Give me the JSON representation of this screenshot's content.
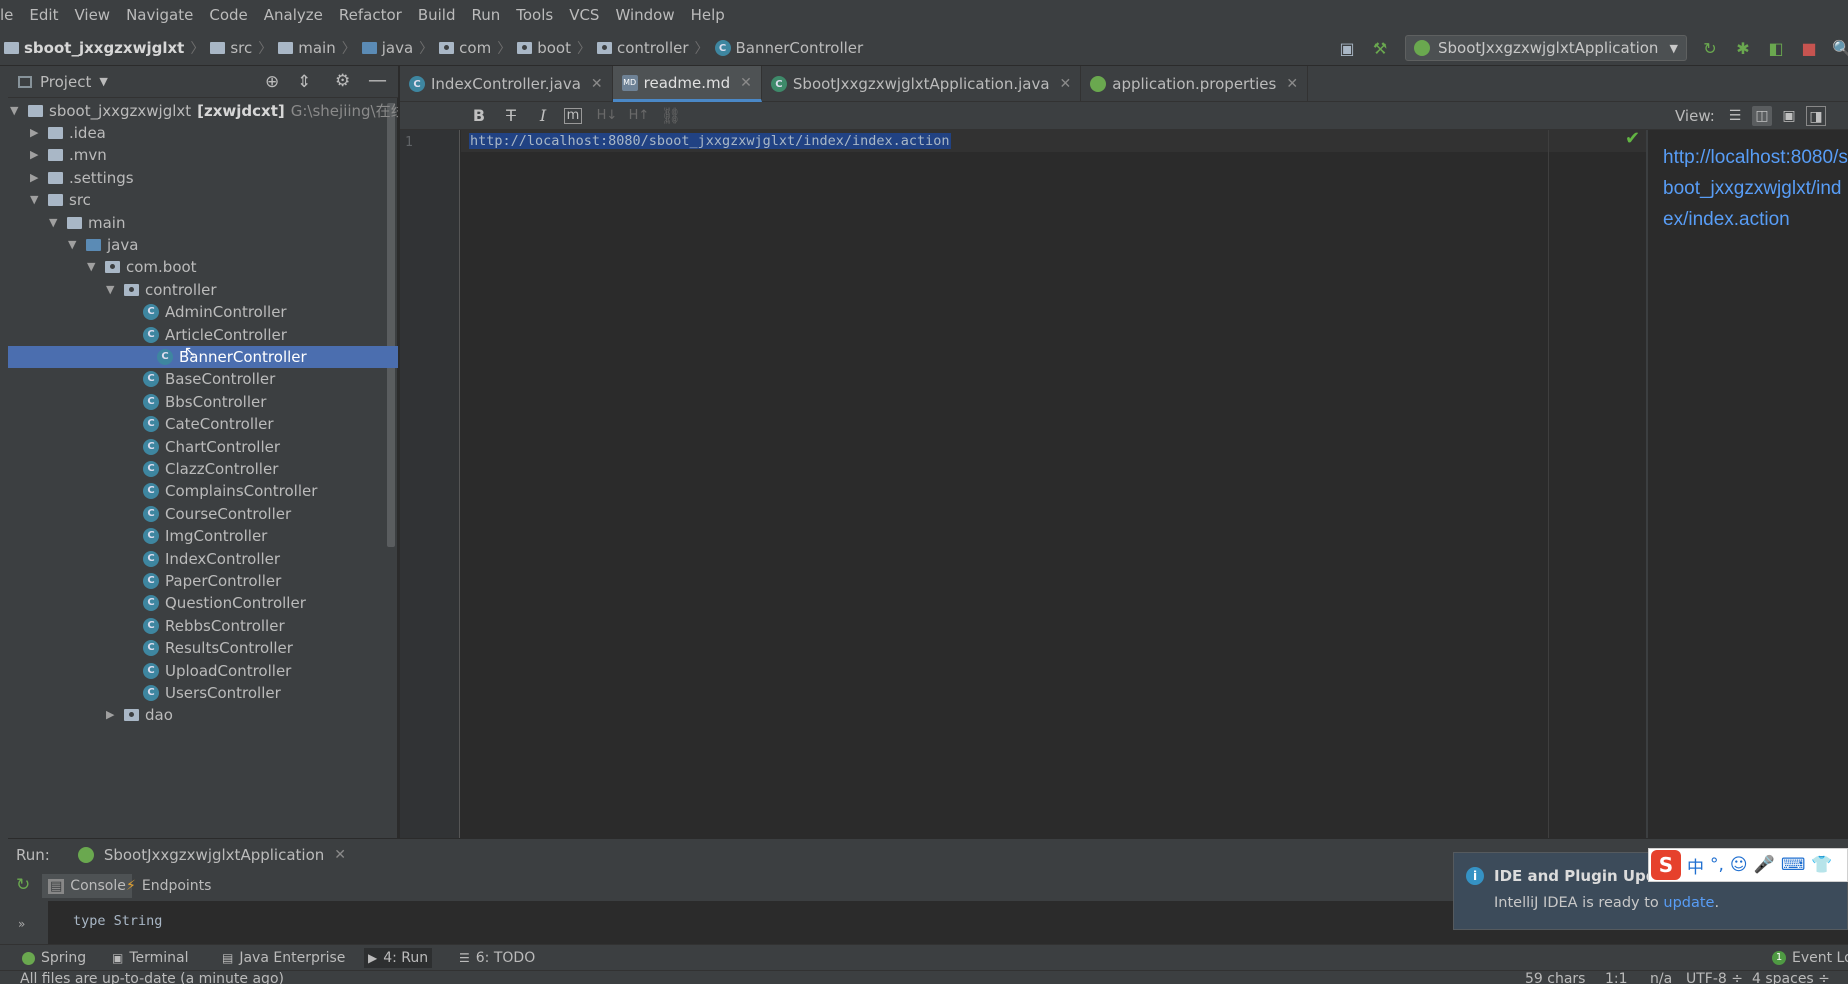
{
  "menu": [
    "le",
    "Edit",
    "View",
    "Navigate",
    "Code",
    "Analyze",
    "Refactor",
    "Build",
    "Run",
    "Tools",
    "VCS",
    "Window",
    "Help"
  ],
  "breadcrumb": [
    "sboot_jxxgzxwjglxt",
    "src",
    "main",
    "java",
    "com",
    "boot",
    "controller",
    "BannerController"
  ],
  "run_config": {
    "label": "SbootJxxgzxwjglxtApplication",
    "icons": [
      "build-hammer-icon",
      "rerun-icon",
      "debug-icon",
      "coverage-icon",
      "stop-icon",
      "search-icon"
    ]
  },
  "project": {
    "header": "Project",
    "root_name": "sboot_jxxgzxwjglxt",
    "root_module": "[zxwjdcxt]",
    "root_path": "G:\\shejiing\\在线",
    "tree": [
      {
        "label": ".idea",
        "type": "folder",
        "depth": 1,
        "expanded": false
      },
      {
        "label": ".mvn",
        "type": "folder",
        "depth": 1,
        "expanded": false
      },
      {
        "label": ".settings",
        "type": "folder",
        "depth": 1,
        "expanded": false
      },
      {
        "label": "src",
        "type": "folder",
        "depth": 1,
        "expanded": true
      },
      {
        "label": "main",
        "type": "folder",
        "depth": 2,
        "expanded": true
      },
      {
        "label": "java",
        "type": "source",
        "depth": 3,
        "expanded": true
      },
      {
        "label": "com.boot",
        "type": "package",
        "depth": 4,
        "expanded": true
      },
      {
        "label": "controller",
        "type": "package",
        "depth": 5,
        "expanded": true
      },
      {
        "label": "AdminController",
        "type": "class",
        "depth": 6
      },
      {
        "label": "ArticleController",
        "type": "class",
        "depth": 6
      },
      {
        "label": "BannerController",
        "type": "class",
        "depth": 6,
        "selected": true
      },
      {
        "label": "BaseController",
        "type": "class",
        "depth": 6
      },
      {
        "label": "BbsController",
        "type": "class",
        "depth": 6
      },
      {
        "label": "CateController",
        "type": "class",
        "depth": 6
      },
      {
        "label": "ChartController",
        "type": "class",
        "depth": 6
      },
      {
        "label": "ClazzController",
        "type": "class",
        "depth": 6
      },
      {
        "label": "ComplainsController",
        "type": "class",
        "depth": 6
      },
      {
        "label": "CourseController",
        "type": "class",
        "depth": 6
      },
      {
        "label": "ImgController",
        "type": "class",
        "depth": 6
      },
      {
        "label": "IndexController",
        "type": "class",
        "depth": 6
      },
      {
        "label": "PaperController",
        "type": "class",
        "depth": 6
      },
      {
        "label": "QuestionController",
        "type": "class",
        "depth": 6
      },
      {
        "label": "RebbsController",
        "type": "class",
        "depth": 6
      },
      {
        "label": "ResultsController",
        "type": "class",
        "depth": 6
      },
      {
        "label": "UploadController",
        "type": "class",
        "depth": 6
      },
      {
        "label": "UsersController",
        "type": "class",
        "depth": 6
      },
      {
        "label": "dao",
        "type": "package",
        "depth": 5,
        "expanded": false
      }
    ]
  },
  "tabs": [
    {
      "label": "IndexController.java",
      "icon": "java-class-icon",
      "active": false
    },
    {
      "label": "readme.md",
      "icon": "markdown-file-icon",
      "active": true
    },
    {
      "label": "SbootJxxgzxwjglxtApplication.java",
      "icon": "spring-boot-icon",
      "active": false
    },
    {
      "label": "application.properties",
      "icon": "spring-properties-icon",
      "active": false
    }
  ],
  "md_toolbar": {
    "view_label": "View:",
    "buttons": [
      "bold",
      "strikethrough",
      "italic",
      "code",
      "header-down",
      "header-up",
      "link"
    ]
  },
  "editor": {
    "line_number": "1",
    "code": "http://localhost:8080/sboot_jxxgzxwjglxt/index/index.action",
    "preview": "http://localhost:8080/sboot_jxxgzxwjglxt/index/index.action"
  },
  "run_panel": {
    "label": "Run:",
    "config": "SbootJxxgzxwjglxtApplication",
    "subtabs": [
      "Console",
      "Endpoints"
    ],
    "console_line": "type String"
  },
  "notification": {
    "title": "IDE and Plugin Upda",
    "body_prefix": "IntelliJ IDEA is ready to ",
    "body_link": "update",
    "body_suffix": "."
  },
  "ime": {
    "items": [
      "中",
      "°,",
      "☺",
      "🎤",
      "⌨",
      "👕"
    ]
  },
  "bottom_tabs": [
    {
      "label": "Spring",
      "icon": "spring-icon"
    },
    {
      "label": "Terminal",
      "icon": "terminal-icon"
    },
    {
      "label": "Java Enterprise",
      "icon": "java-enterprise-icon"
    },
    {
      "label": "4: Run",
      "icon": "run-icon",
      "active": true
    },
    {
      "label": "6: TODO",
      "icon": "todo-icon"
    }
  ],
  "event_log": {
    "count": "1",
    "label": "Event Lo"
  },
  "status": {
    "message": "All files are up-to-date (a minute ago)",
    "chars": "59 chars",
    "position": "1:1",
    "line_sep": "n/a",
    "encoding": "UTF-8 ÷",
    "indent": "4 spaces ÷"
  },
  "colors": {
    "selection": "#4b6eaf",
    "link": "#589df6",
    "background": "#2b2b2b",
    "panel": "#3c3f41"
  }
}
